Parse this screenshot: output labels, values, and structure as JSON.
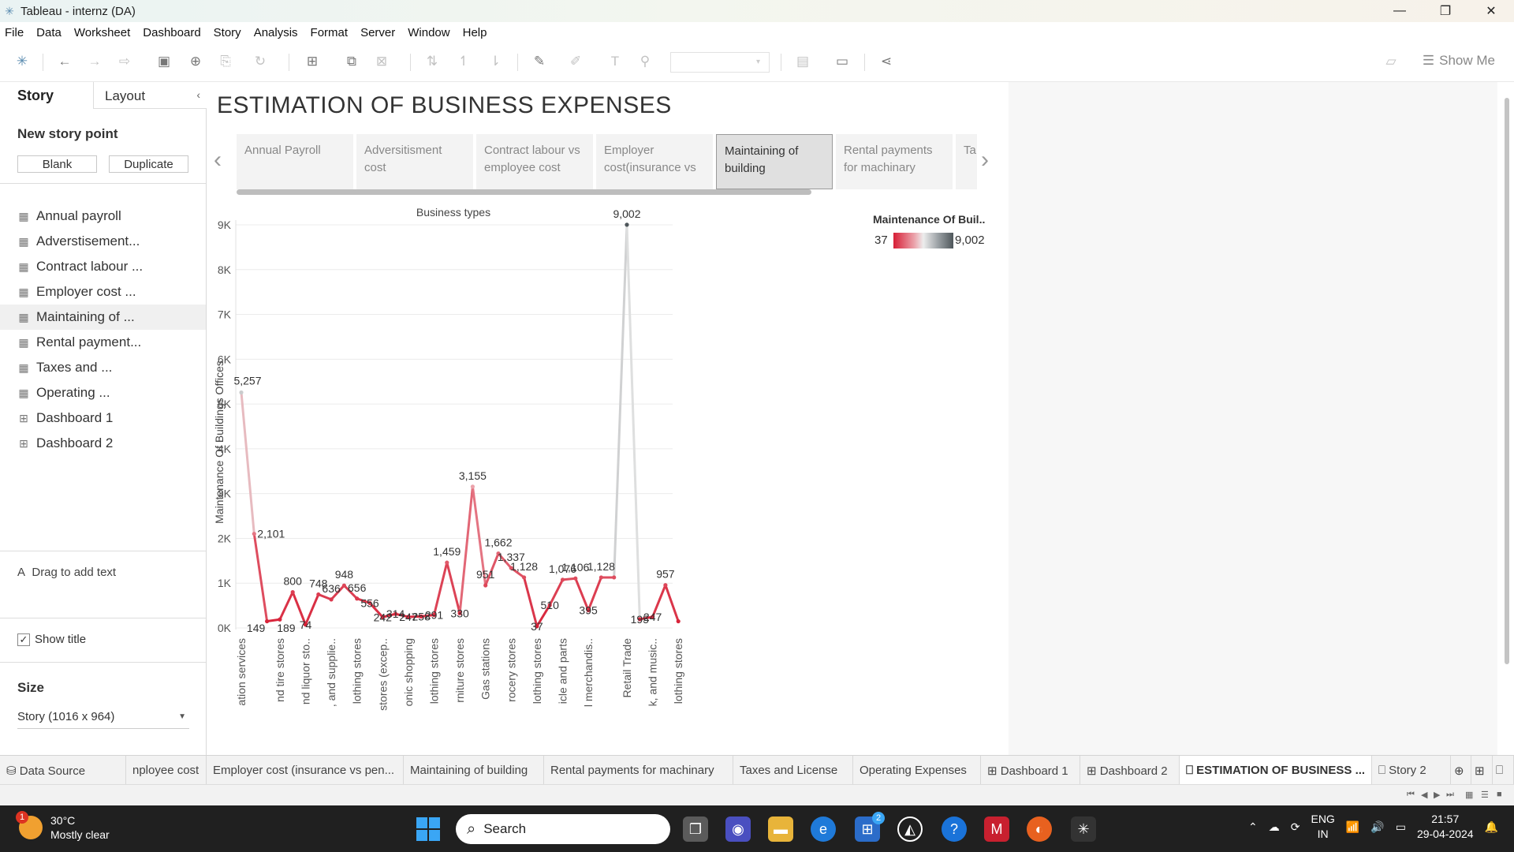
{
  "window": {
    "title": "Tableau - internz (DA)",
    "minimize": "—",
    "maximize": "❐",
    "close": "✕"
  },
  "menu": [
    "File",
    "Data",
    "Worksheet",
    "Dashboard",
    "Story",
    "Analysis",
    "Format",
    "Server",
    "Window",
    "Help"
  ],
  "toolbar": {
    "show_me": "Show Me"
  },
  "left_pane": {
    "tab_story": "Story",
    "tab_layout": "Layout",
    "new_story_point": "New story point",
    "blank_button": "Blank",
    "duplicate_button": "Duplicate",
    "sheets": [
      {
        "label": "Annual payroll",
        "type": "sheet"
      },
      {
        "label": "Adverstisement...",
        "type": "sheet"
      },
      {
        "label": "Contract labour ...",
        "type": "sheet"
      },
      {
        "label": "Employer cost ...",
        "type": "sheet"
      },
      {
        "label": "Maintaining of ...",
        "type": "sheet",
        "active": true
      },
      {
        "label": "Rental payment...",
        "type": "sheet"
      },
      {
        "label": "Taxes and ...",
        "type": "sheet"
      },
      {
        "label": "Operating ...",
        "type": "sheet"
      },
      {
        "label": "Dashboard 1",
        "type": "dashboard"
      },
      {
        "label": "Dashboard 2",
        "type": "dashboard"
      }
    ],
    "drag_to_add_text": "Drag to add text",
    "show_title": "Show title",
    "size_title": "Size",
    "size_value": "Story (1016 x 964)"
  },
  "story": {
    "title": "ESTIMATION OF BUSINESS EXPENSES",
    "captions": [
      {
        "line1": "Annual Payroll",
        "line2": ""
      },
      {
        "line1": "Adversitisment",
        "line2": "cost"
      },
      {
        "line1": "Contract labour vs",
        "line2": "employee cost"
      },
      {
        "line1": "Employer",
        "line2": "cost(insurance vs"
      },
      {
        "line1": "Maintaining of",
        "line2": "building",
        "active": true
      },
      {
        "line1": "Rental payments",
        "line2": "for machinary"
      },
      {
        "line1": "Ta",
        "line2": ""
      }
    ],
    "nav_prev": "‹",
    "nav_next": "›"
  },
  "legend": {
    "title": "Maintenance Of Buil..",
    "min": "37",
    "max": "9,002"
  },
  "chart_data": {
    "type": "line",
    "title": "Business types",
    "xlabel": "",
    "ylabel": "Maintenance Of Buildings Offices",
    "ylim": [
      0,
      9000
    ],
    "yticks": [
      {
        "value": 0,
        "label": "0K"
      },
      {
        "value": 1000,
        "label": "1K"
      },
      {
        "value": 2000,
        "label": "2K"
      },
      {
        "value": 3000,
        "label": "3K"
      },
      {
        "value": 4000,
        "label": "4K"
      },
      {
        "value": 5000,
        "label": "5K"
      },
      {
        "value": 6000,
        "label": "6K"
      },
      {
        "value": 7000,
        "label": "7K"
      },
      {
        "value": 8000,
        "label": "8K"
      },
      {
        "value": 9000,
        "label": "9K"
      }
    ],
    "color_range": [
      37,
      9002
    ],
    "values": [
      5257,
      2101,
      149,
      189,
      800,
      74,
      748,
      636,
      948,
      656,
      556,
      242,
      314,
      247,
      258,
      291,
      1459,
      330,
      3155,
      951,
      1662,
      1337,
      1128,
      37,
      510,
      1076,
      1106,
      395,
      1128,
      1128,
      9002,
      195,
      247,
      957,
      149
    ],
    "point_labels": [
      "5,257",
      "2,101",
      "149",
      "",
      "800",
      "74",
      "748",
      "636",
      "948",
      "656",
      "556",
      "242",
      "314",
      "247",
      "258",
      "291",
      "1,459",
      "330",
      "3,155",
      "951",
      "1,662",
      "1,337",
      "1,128",
      "37",
      "510",
      "1,076",
      "1,106",
      "395",
      "1,128",
      "",
      "9,002",
      "195",
      "247",
      "957",
      ""
    ],
    "extra_labels": [
      "189"
    ],
    "x_labels": [
      {
        "index": 0,
        "label": "ation services"
      },
      {
        "index": 3,
        "label": "nd tire stores"
      },
      {
        "index": 5,
        "label": "nd liquor sto.."
      },
      {
        "index": 7,
        "label": ", and supplie.."
      },
      {
        "index": 9,
        "label": "lothing stores"
      },
      {
        "index": 11,
        "label": "stores (excep.."
      },
      {
        "index": 13,
        "label": "onic shopping"
      },
      {
        "index": 15,
        "label": "lothing stores"
      },
      {
        "index": 17,
        "label": "rniture stores"
      },
      {
        "index": 19,
        "label": "Gas stations"
      },
      {
        "index": 21,
        "label": "rocery stores"
      },
      {
        "index": 23,
        "label": "lothing stores"
      },
      {
        "index": 25,
        "label": "icle and parts"
      },
      {
        "index": 27,
        "label": "l merchandis.."
      },
      {
        "index": 30,
        "label": "Retail Trade"
      },
      {
        "index": 32,
        "label": "k, and music.."
      },
      {
        "index": 34,
        "label": "lothing stores"
      }
    ]
  },
  "sheet_tabs": [
    {
      "label": "Data Source",
      "icon": "db"
    },
    {
      "label": "nployee cost",
      "icon": ""
    },
    {
      "label": "Employer cost (insurance vs pen...",
      "icon": ""
    },
    {
      "label": "Maintaining of building",
      "icon": ""
    },
    {
      "label": "Rental payments for machinary",
      "icon": ""
    },
    {
      "label": "Taxes and License",
      "icon": ""
    },
    {
      "label": "Operating Expenses",
      "icon": ""
    },
    {
      "label": "Dashboard 1",
      "icon": "dash"
    },
    {
      "label": "Dashboard 2",
      "icon": "dash"
    },
    {
      "label": "ESTIMATION OF BUSINESS ...",
      "icon": "story",
      "active": true
    },
    {
      "label": "Story 2",
      "icon": "story"
    }
  ],
  "taskbar": {
    "temperature": "30°C",
    "weather": "Mostly clear",
    "weather_badge": "1",
    "search_placeholder": "Search",
    "store_badge": "2",
    "lang1": "ENG",
    "lang2": "IN",
    "time": "21:57",
    "date": "29-04-2024"
  }
}
